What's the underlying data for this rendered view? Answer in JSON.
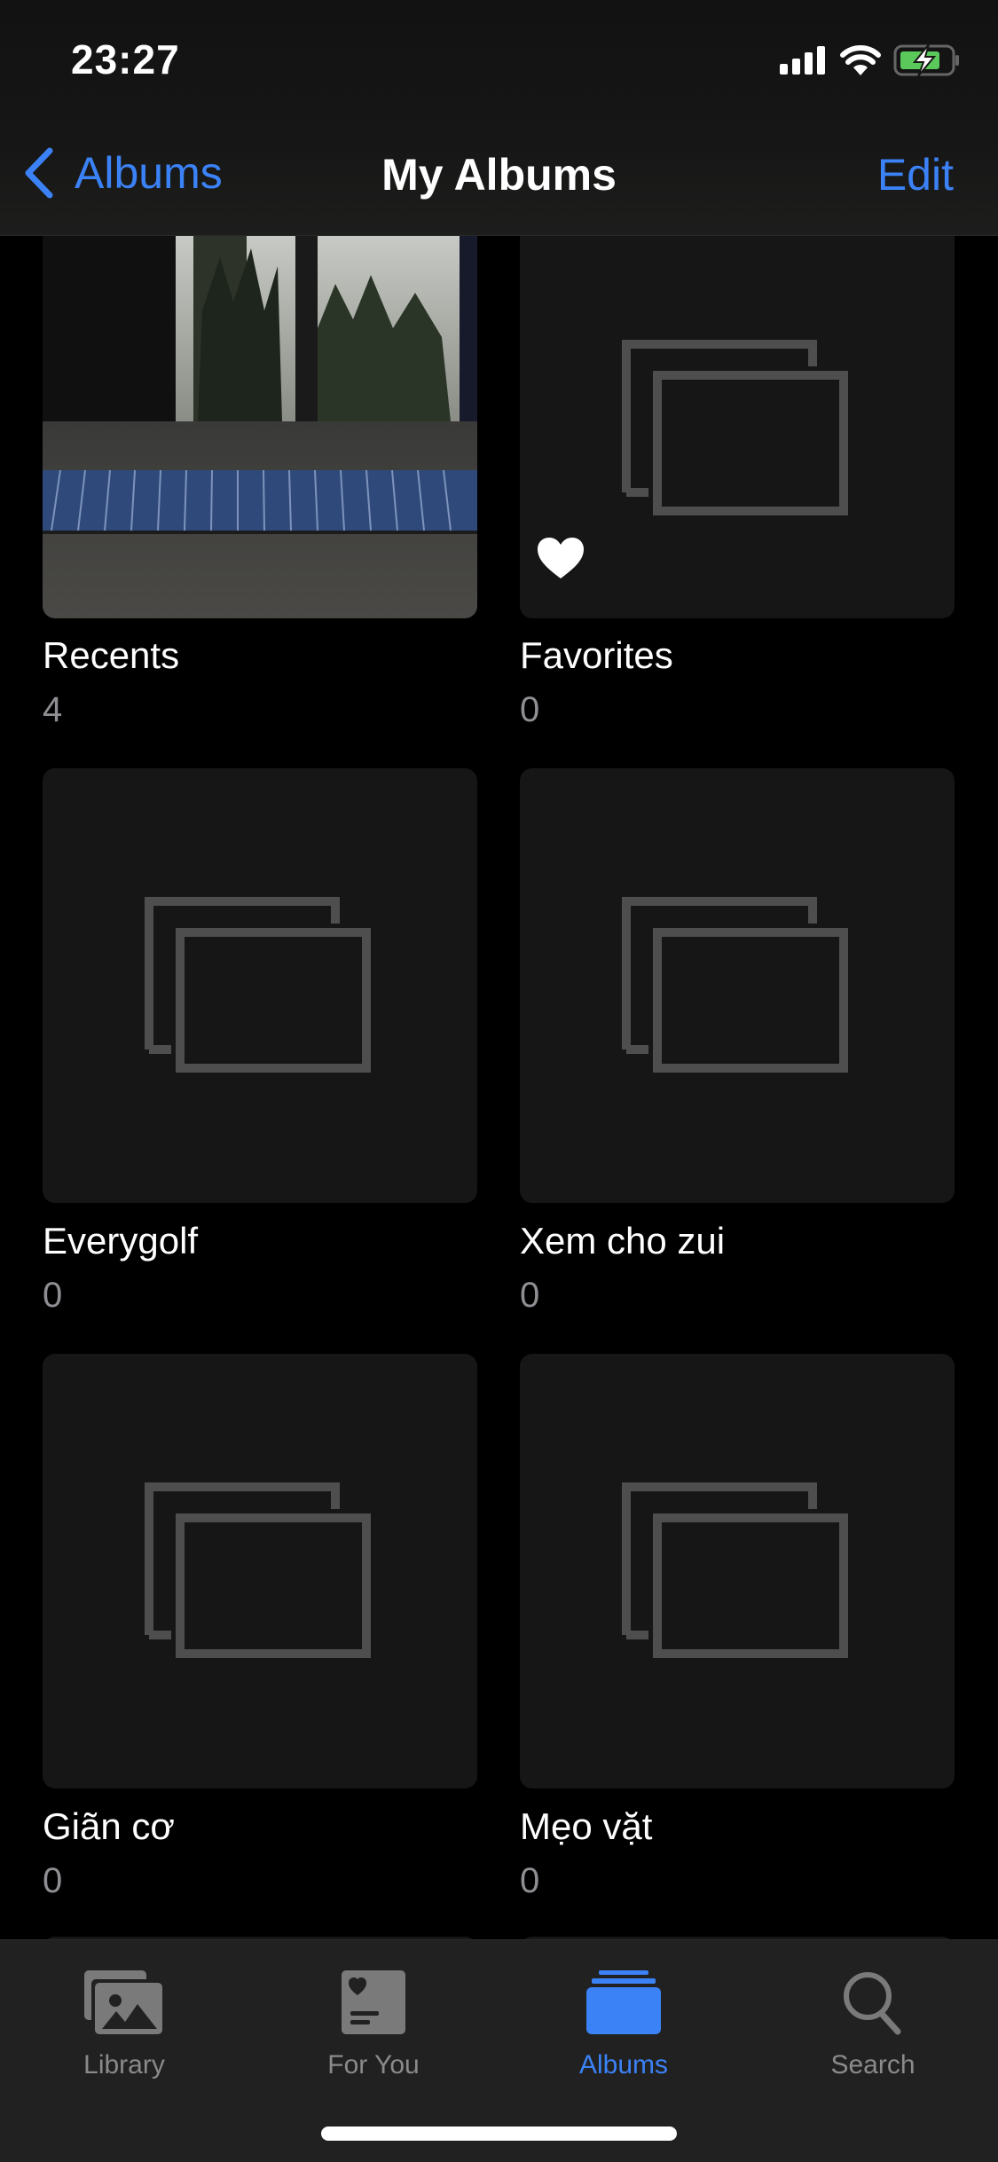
{
  "status_bar": {
    "time": "23:27",
    "icons": [
      "cellular-signal-icon",
      "wifi-icon",
      "battery-charging-icon"
    ],
    "battery_color": "#5ac85a"
  },
  "nav": {
    "back_label": "Albums",
    "title": "My Albums",
    "edit_label": "Edit",
    "accent_color": "#3b82f6"
  },
  "albums": [
    {
      "name": "Recents",
      "count": "4",
      "thumbnail": "photo"
    },
    {
      "name": "Favorites",
      "count": "0",
      "thumbnail": "empty",
      "badge": "heart-icon"
    },
    {
      "name": "Everygolf",
      "count": "0",
      "thumbnail": "empty"
    },
    {
      "name": "Xem cho zui",
      "count": "0",
      "thumbnail": "empty"
    },
    {
      "name": "Giãn cơ",
      "count": "0",
      "thumbnail": "empty"
    },
    {
      "name": "Mẹo vặt",
      "count": "0",
      "thumbnail": "empty"
    }
  ],
  "tabbar": {
    "tabs": [
      {
        "label": "Library",
        "icon": "photo-library-icon",
        "active": false
      },
      {
        "label": "For You",
        "icon": "for-you-icon",
        "active": false
      },
      {
        "label": "Albums",
        "icon": "albums-icon",
        "active": true
      },
      {
        "label": "Search",
        "icon": "search-icon",
        "active": false
      }
    ]
  }
}
